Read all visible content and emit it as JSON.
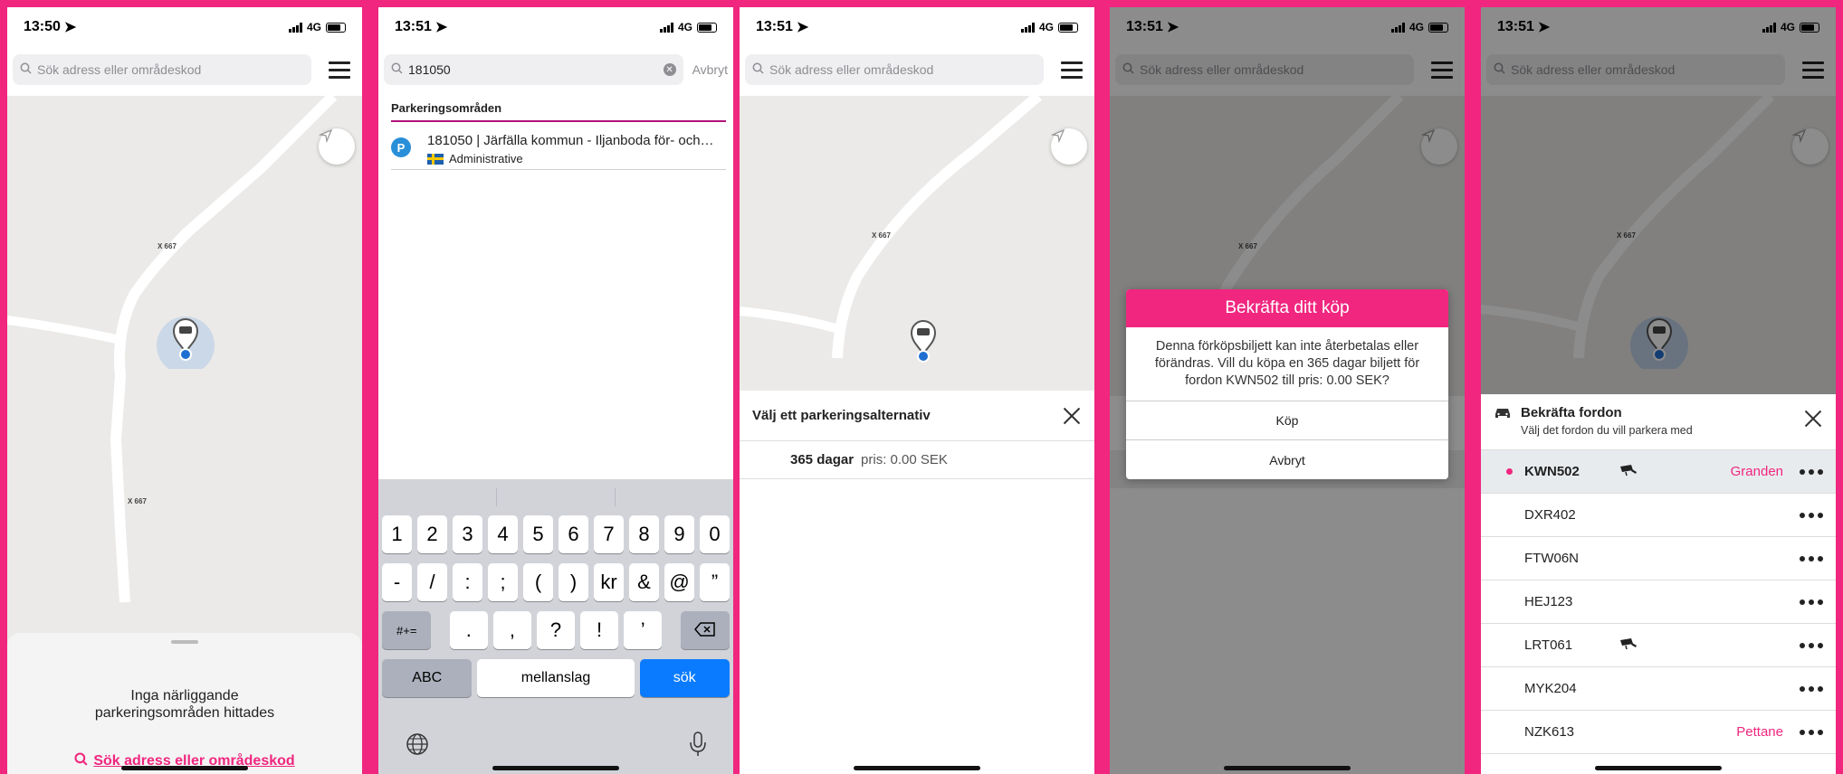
{
  "phone1": {
    "time": "13:50",
    "network": "4G",
    "search_placeholder": "Sök adress eller områdeskod",
    "road_label_a": "X 667",
    "road_label_b": "X 667",
    "sheet_message_line1": "Inga närliggande",
    "sheet_message_line2": "parkeringsområden hittades",
    "sheet_link": "Sök adress eller områdeskod"
  },
  "phone2": {
    "time": "13:51",
    "network": "4G",
    "search_value": "181050",
    "cancel": "Avbryt",
    "section_header": "Parkeringsområden",
    "result_badge": "P",
    "result_title": "181050 | Järfälla kommun - Iljanboda för- och…",
    "result_subtitle": "Administrative",
    "keys_row1": [
      "1",
      "2",
      "3",
      "4",
      "5",
      "6",
      "7",
      "8",
      "9",
      "0"
    ],
    "keys_row2": [
      "-",
      "/",
      ":",
      ";",
      "(",
      ")",
      "kr",
      "&",
      "@",
      "”"
    ],
    "key_symbols": "#+=",
    "keys_row3": [
      ".",
      ",",
      "?",
      "!",
      "’"
    ],
    "key_abc": "ABC",
    "key_space": "mellanslag",
    "key_go": "sök"
  },
  "phone3": {
    "time": "13:51",
    "network": "4G",
    "search_placeholder": "Sök adress eller områdeskod",
    "road_label": "X 667",
    "sheet_title": "Välj ett parkeringsalternativ",
    "option_duration": "365 dagar",
    "option_price": "pris: 0.00 SEK"
  },
  "phone4": {
    "time": "13:51",
    "network": "4G",
    "search_placeholder": "Sök adress eller områdeskod",
    "road_label": "X 667",
    "dialog_title": "Bekräfta ditt köp",
    "dialog_body": "Denna förköpsbiljett kan inte återbetalas eller förändras. Vill du köpa en 365 dagar biljett för fordon KWN502 till pris: 0.00 SEK?",
    "buy": "Köp",
    "cancel": "Avbryt"
  },
  "phone5": {
    "time": "13:51",
    "network": "4G",
    "search_placeholder": "Sök adress eller områdeskod",
    "road_label": "X 667",
    "sheet_title": "Bekräfta fordon",
    "sheet_subtitle": "Välj det fordon du vill parkera med",
    "vehicles": [
      {
        "plate": "KWN502",
        "extra": "Granden"
      },
      {
        "plate": "DXR402",
        "extra": ""
      },
      {
        "plate": "FTW06N",
        "extra": ""
      },
      {
        "plate": "HEJ123",
        "extra": ""
      },
      {
        "plate": "LRT061",
        "extra": ""
      },
      {
        "plate": "MYK204",
        "extra": ""
      },
      {
        "plate": "NZK613",
        "extra": "Pettane"
      }
    ]
  },
  "colors": {
    "brand": "#f0267f",
    "keyboard_go": "#0a7bff"
  }
}
